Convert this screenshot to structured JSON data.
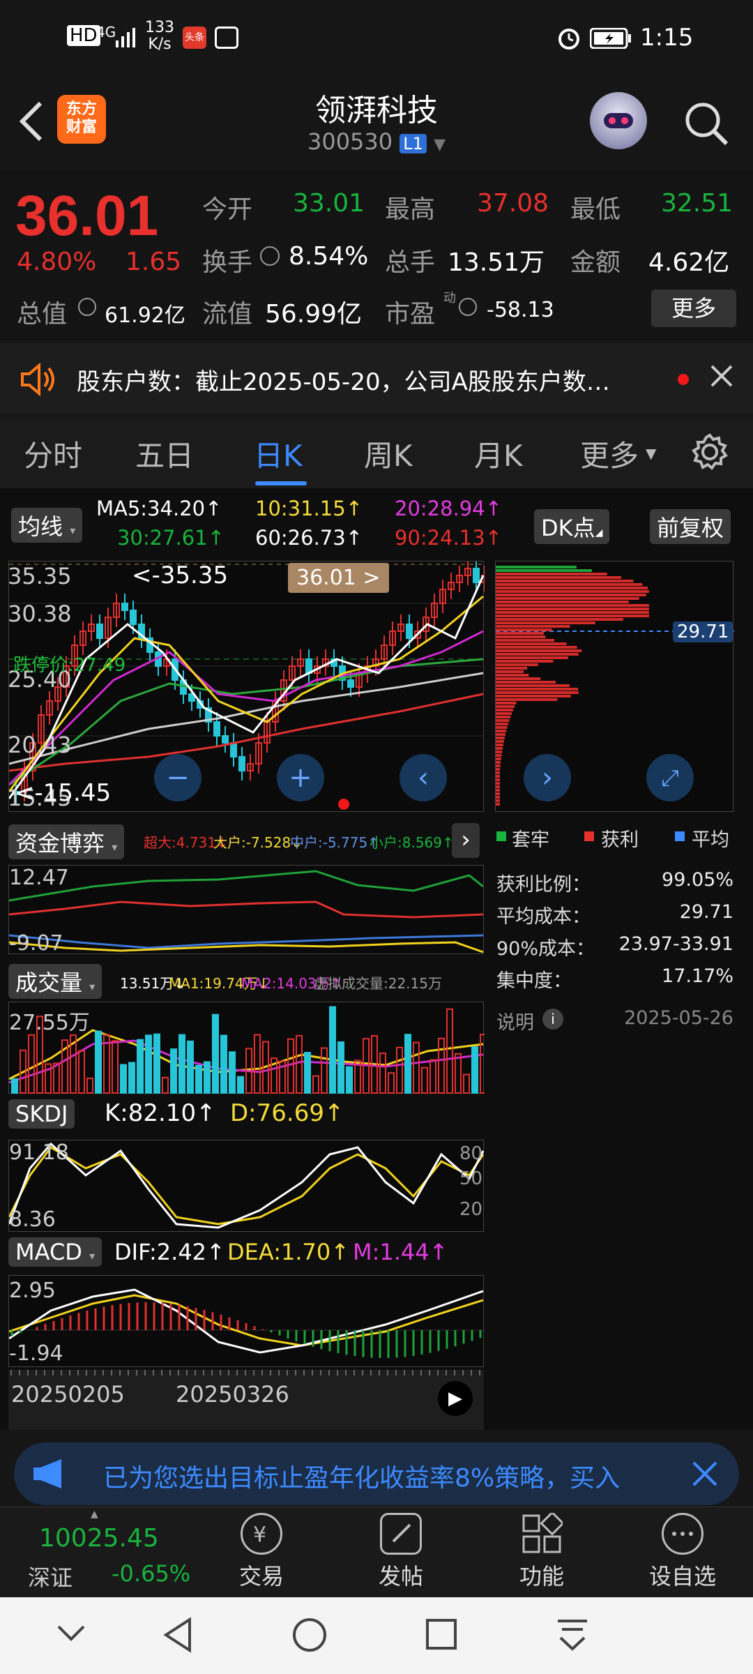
{
  "status_bar": {
    "hd": "HD",
    "net": "4G",
    "speed": "133",
    "speed_unit": "K/s",
    "time": "1:15",
    "notif_label": "头条"
  },
  "header": {
    "logo_line1": "东方",
    "logo_line2": "财富",
    "stock_name": "领湃科技",
    "stock_code": "300530",
    "level": "L1"
  },
  "quote": {
    "price": "36.01",
    "change_pct": "4.80%",
    "change_abs": "1.65",
    "open_label": "今开",
    "open": "33.01",
    "high_label": "最高",
    "high": "37.08",
    "low_label": "最低",
    "low": "32.51",
    "turnover_label": "换手",
    "turnover": "8.54%",
    "volume_label": "总手",
    "volume": "13.51万",
    "amount_label": "金额",
    "amount": "4.62亿",
    "mktcap_label": "总值",
    "mktcap": "61.92亿",
    "float_label": "流值",
    "float": "56.99亿",
    "pe_label": "市盈",
    "pe_sup": "动",
    "pe": "-58.13",
    "more_label": "更多"
  },
  "notice": {
    "text": "股东户数：截止2025-05-20，公司A股股东户数…"
  },
  "tabs": [
    "分时",
    "五日",
    "日K",
    "周K",
    "月K",
    "更多"
  ],
  "active_tab": "日K",
  "kline": {
    "ma_label": "均线",
    "ma5": "MA5:34.20↑",
    "ma10": "10:31.15↑",
    "ma20": "20:28.94↑",
    "ma30": "30:27.61↑",
    "ma60": "60:26.73↑",
    "ma90": "90:24.13↑",
    "dk_label": "DK点",
    "adj_label": "前复权",
    "y_top": "35.35",
    "y2": "30.38",
    "y3": "25.40",
    "y4": "20.43",
    "y5": "15.45",
    "max_marker": "<-35.35",
    "min_marker": "<-15.45",
    "price_tag": "36.01 >",
    "limit_label": "跌停价:27.49"
  },
  "chip": {
    "avg_tag": "29.71",
    "legend": [
      "套牢",
      "获利",
      "平均"
    ],
    "profit_ratio_label": "获利比例：",
    "profit_ratio": "99.05%",
    "avg_cost_label": "平均成本：",
    "avg_cost": "29.71",
    "cost90_label": "90%成本：",
    "cost90": "23.97-33.91",
    "concentration_label": "集中度：",
    "concentration": "17.17%",
    "note_label": "说明",
    "date": "2025-05-26"
  },
  "fund": {
    "label": "资金博弈",
    "super": "超大:4.731↓",
    "big": "大户:-7.528↓",
    "mid": "中户:-5.775↑",
    "small": "小户:8.569↑",
    "y_top": "12.47",
    "y_bot": "-9.07"
  },
  "vol": {
    "label": "成交量",
    "v": "13.51万↓",
    "ma1": "MA1:19.74万↓",
    "ma2": "MA2:14.03万↑",
    "virt": "虚拟成交量:22.15万",
    "y_top": "27.55万"
  },
  "skdj": {
    "label": "SKDJ",
    "k": "K:82.10↑",
    "d": "D:76.69↑",
    "y_top": "91.18",
    "y_bot": "8.36",
    "r80": "80",
    "r50": "50",
    "r20": "20"
  },
  "macd": {
    "label": "MACD",
    "dif": "DIF:2.42↑",
    "dea": "DEA:1.70↑",
    "m": "M:1.44↑",
    "y_top": "2.95",
    "y_bot": "-1.94"
  },
  "dates": [
    "20250205",
    "20250326"
  ],
  "ad": {
    "text": "已为您选出目标止盈年化收益率8%策略，买入"
  },
  "bottom": {
    "index_value": "10025.45",
    "index_name": "深证",
    "index_change": "-0.65%",
    "items": [
      "交易",
      "发帖",
      "功能",
      "设自选"
    ]
  },
  "colors": {
    "up": "#e8302c",
    "down": "#18b43d",
    "accent": "#3d8bff",
    "bg": "#161616"
  }
}
